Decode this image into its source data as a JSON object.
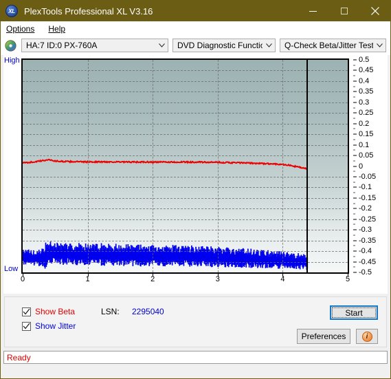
{
  "window": {
    "title": "PlexTools Professional XL V3.16",
    "app_icon": "xl-logo-icon",
    "minimize_label": "—",
    "maximize_label": "☐",
    "close_label": "✕"
  },
  "menubar": {
    "items": [
      {
        "label": "Options",
        "accel": "O"
      },
      {
        "label": "Help",
        "accel": "H"
      }
    ]
  },
  "toolbar": {
    "disc_icon": "optical-disc-icon",
    "drive_combo": {
      "value": "HA:7 ID:0  PX-760A"
    },
    "function_combo": {
      "value": "DVD Diagnostic Functions"
    },
    "test_combo": {
      "value": "Q-Check Beta/Jitter Test"
    }
  },
  "chart_panel": {
    "axis_high_label": "High",
    "axis_low_label": "Low",
    "y_ticks": [
      "0.5",
      "0.45",
      "0.4",
      "0.35",
      "0.3",
      "0.25",
      "0.2",
      "0.15",
      "0.1",
      "0.05",
      "0",
      "-0.05",
      "-0.1",
      "-0.15",
      "-0.2",
      "-0.25",
      "-0.3",
      "-0.35",
      "-0.4",
      "-0.45",
      "-0.5"
    ],
    "x_ticks": [
      "0",
      "1",
      "2",
      "3",
      "4",
      "5"
    ]
  },
  "chart_data": {
    "type": "line",
    "title": "Q-Check Beta/Jitter Test",
    "xlabel": "",
    "ylabel": "",
    "xlim": [
      0,
      5
    ],
    "ylim": [
      -0.5,
      0.5
    ],
    "grid": true,
    "legend_position": "bottom-left",
    "data_end_x": 4.37,
    "y_tick_step": 0.05,
    "x_tick_step": 1,
    "series": [
      {
        "name": "Show Beta",
        "color": "#ee0000",
        "type": "line",
        "x": [
          0.0,
          0.05,
          0.1,
          0.15,
          0.2,
          0.25,
          0.3,
          0.35,
          0.4,
          0.45,
          0.5,
          0.55,
          0.6,
          0.65,
          0.7,
          0.75,
          0.8,
          0.85,
          0.9,
          0.95,
          1.0,
          1.1,
          1.2,
          1.3,
          1.4,
          1.5,
          1.6,
          1.7,
          1.8,
          1.9,
          2.0,
          2.1,
          2.2,
          2.3,
          2.4,
          2.5,
          2.6,
          2.7,
          2.8,
          2.9,
          3.0,
          3.1,
          3.2,
          3.3,
          3.4,
          3.5,
          3.6,
          3.7,
          3.8,
          3.9,
          4.0,
          4.05,
          4.1,
          4.15,
          4.2,
          4.25,
          4.3,
          4.35,
          4.37
        ],
        "y": [
          0.015,
          0.016,
          0.018,
          0.019,
          0.021,
          0.023,
          0.025,
          0.028,
          0.031,
          0.027,
          0.024,
          0.023,
          0.022,
          0.022,
          0.021,
          0.021,
          0.021,
          0.021,
          0.02,
          0.02,
          0.02,
          0.02,
          0.02,
          0.02,
          0.02,
          0.019,
          0.019,
          0.019,
          0.019,
          0.019,
          0.019,
          0.019,
          0.019,
          0.019,
          0.019,
          0.019,
          0.019,
          0.019,
          0.018,
          0.018,
          0.018,
          0.017,
          0.016,
          0.016,
          0.015,
          0.014,
          0.013,
          0.012,
          0.011,
          0.01,
          0.008,
          0.006,
          0.004,
          0.001,
          -0.002,
          -0.005,
          -0.008,
          -0.011,
          -0.013
        ],
        "noise_amplitude": 0.006
      },
      {
        "name": "Show Jitter",
        "color": "#0000ee",
        "type": "area-noise",
        "x": [
          0.0,
          0.1,
          0.2,
          0.3,
          0.35,
          0.4,
          0.5,
          0.6,
          0.7,
          0.8,
          0.9,
          1.0,
          1.2,
          1.4,
          1.6,
          1.8,
          2.0,
          2.2,
          2.4,
          2.6,
          2.8,
          3.0,
          3.2,
          3.4,
          3.6,
          3.8,
          4.0,
          4.2,
          4.37
        ],
        "y_top": [
          -0.4,
          -0.398,
          -0.405,
          -0.398,
          -0.368,
          -0.366,
          -0.37,
          -0.368,
          -0.37,
          -0.372,
          -0.374,
          -0.376,
          -0.374,
          -0.376,
          -0.378,
          -0.38,
          -0.382,
          -0.38,
          -0.382,
          -0.384,
          -0.388,
          -0.39,
          -0.392,
          -0.396,
          -0.402,
          -0.406,
          -0.41,
          -0.416,
          -0.424
        ],
        "y_bottom": [
          -0.455,
          -0.458,
          -0.462,
          -0.47,
          -0.468,
          -0.452,
          -0.45,
          -0.452,
          -0.452,
          -0.454,
          -0.455,
          -0.456,
          -0.456,
          -0.458,
          -0.458,
          -0.46,
          -0.46,
          -0.46,
          -0.462,
          -0.462,
          -0.464,
          -0.466,
          -0.466,
          -0.468,
          -0.47,
          -0.472,
          -0.474,
          -0.476,
          -0.48
        ]
      }
    ]
  },
  "controls": {
    "show_beta": {
      "label": "Show Beta",
      "accel": "B",
      "checked": true
    },
    "show_jitter": {
      "label": "Show Jitter",
      "accel": "J",
      "checked": true
    },
    "lsn_label": "LSN:",
    "lsn_value": "2295040",
    "start_button": "Start",
    "preferences_button": "Preferences",
    "info_button_icon": "info-icon"
  },
  "statusbar": {
    "text": "Ready"
  }
}
